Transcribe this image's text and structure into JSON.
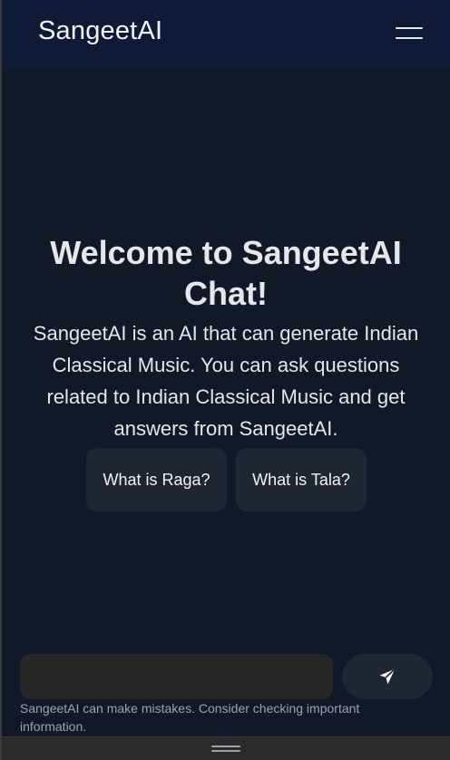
{
  "header": {
    "brand": "SangeetAI",
    "menu_icon": "hamburger-menu-icon"
  },
  "welcome": {
    "title": "Welcome to SangeetAI Chat!",
    "description": "SangeetAI is an AI that can generate Indian Classical Music. You can ask questions related to Indian Classical Music and get answers from SangeetAI."
  },
  "suggestions": [
    {
      "label": "What is Raga?"
    },
    {
      "label": "What is Tala?"
    }
  ],
  "composer": {
    "value": "",
    "placeholder": "",
    "send_icon": "send-icon"
  },
  "disclaimer": "SangeetAI can make mistakes. Consider checking important information.",
  "colors": {
    "background": "#111827",
    "header": "#0f1a36",
    "chip": "#1f2532",
    "input": "#262626",
    "text": "#e5e7eb",
    "muted": "#9ca3af"
  }
}
